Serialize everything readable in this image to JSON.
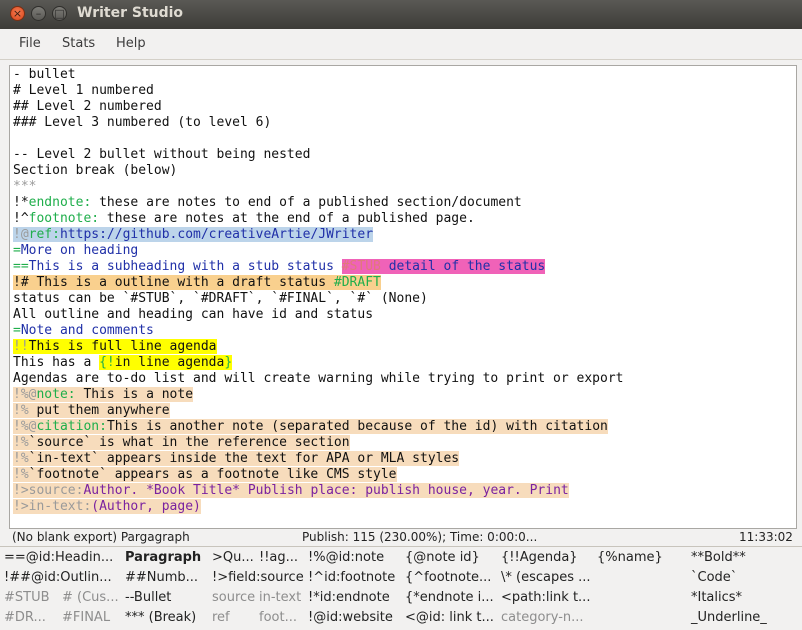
{
  "window": {
    "title": "Writer Studio"
  },
  "menu": [
    "File",
    "Stats",
    "Help"
  ],
  "editor_lines": [
    [
      {
        "t": "- bullet"
      }
    ],
    [
      {
        "t": "# Level 1 numbered"
      }
    ],
    [
      {
        "t": "## Level 2 numbered"
      }
    ],
    [
      {
        "t": "### Level 3 numbered (to level 6)"
      }
    ],
    [
      {
        "t": ""
      }
    ],
    [
      {
        "t": "-- Level 2 bullet without being nested"
      }
    ],
    [
      {
        "t": "Section break (below)"
      }
    ],
    [
      {
        "t": "***",
        "c": "gr"
      }
    ],
    [
      {
        "t": "!*",
        "c": ""
      },
      {
        "t": "endnote:",
        "c": "g"
      },
      {
        "t": " these are notes to end of a published section/document"
      }
    ],
    [
      {
        "t": "!^",
        "c": ""
      },
      {
        "t": "footnote:",
        "c": "g"
      },
      {
        "t": " these are notes at the end of a published page."
      }
    ],
    [
      {
        "t": "!@",
        "c": "hl-blue gr"
      },
      {
        "t": "ref:",
        "c": "hl-blue g"
      },
      {
        "t": "https://github.com/creativeArtie/JWriter",
        "c": "hl-blue bl"
      }
    ],
    [
      {
        "t": "=",
        "c": "g"
      },
      {
        "t": "More on heading",
        "c": "bl"
      }
    ],
    [
      {
        "t": "==",
        "c": "g"
      },
      {
        "t": "This is a subheading with a stub status ",
        "c": "bl"
      },
      {
        "t": "#STUB",
        "c": "hl-pink pi"
      },
      {
        "t": " detail of the status",
        "c": "hl-pink bl"
      }
    ],
    [
      {
        "t": "!# This is a outline with a draft status ",
        "c": "hl-orange"
      },
      {
        "t": "#DRAFT",
        "c": "hl-orange g"
      }
    ],
    [
      {
        "t": "status can be `#STUB`, `#DRAFT`, `#FINAL`, `#` (None)"
      }
    ],
    [
      {
        "t": "All outline and heading can have id and status"
      }
    ],
    [
      {
        "t": "=",
        "c": "g"
      },
      {
        "t": "Note and comments",
        "c": "bl"
      }
    ],
    [
      {
        "t": "!!",
        "c": "hl-yellow gr"
      },
      {
        "t": "This is full line agenda",
        "c": "hl-yellow"
      }
    ],
    [
      {
        "t": "This has a "
      },
      {
        "t": "{!",
        "c": "hl-yellow g"
      },
      {
        "t": "in line agenda",
        "c": "hl-yellow"
      },
      {
        "t": "}",
        "c": "hl-yellow g"
      }
    ],
    [
      {
        "t": "Agendas are to-do list and will create warning while trying to print or export"
      }
    ],
    [
      {
        "t": "!%@",
        "c": "hl-peach gr"
      },
      {
        "t": "note:",
        "c": "hl-peach g"
      },
      {
        "t": " This is a note",
        "c": "hl-peach"
      }
    ],
    [
      {
        "t": "!%",
        "c": "hl-peach gr"
      },
      {
        "t": " put them anywhere",
        "c": "hl-peach"
      }
    ],
    [
      {
        "t": "!%@",
        "c": "hl-peach gr"
      },
      {
        "t": "citation:",
        "c": "hl-peach g"
      },
      {
        "t": "This is another note (separated because of the id) with citation",
        "c": "hl-peach"
      }
    ],
    [
      {
        "t": "!%",
        "c": "hl-peach gr"
      },
      {
        "t": "`source` is what in the reference section",
        "c": "hl-peach"
      }
    ],
    [
      {
        "t": "!%",
        "c": "hl-peach gr"
      },
      {
        "t": "`in-text` appears inside the text for APA or MLA styles",
        "c": "hl-peach"
      }
    ],
    [
      {
        "t": "!%",
        "c": "hl-peach gr"
      },
      {
        "t": "`footnote` appears as a footnote like CMS style",
        "c": "hl-peach"
      }
    ],
    [
      {
        "t": "!>",
        "c": "hl-peach gr"
      },
      {
        "t": "source:",
        "c": "hl-peach gr"
      },
      {
        "t": "Author. ",
        "c": "hl-peach pu"
      },
      {
        "t": "*Book Title*",
        "c": "hl-peach pu"
      },
      {
        "t": " Publish place: publish house, year. Print",
        "c": "hl-peach pu"
      }
    ],
    [
      {
        "t": "!>",
        "c": "hl-peach gr"
      },
      {
        "t": "in-text:",
        "c": "hl-peach gr"
      },
      {
        "t": "(Author, page)",
        "c": "hl-peach pu"
      }
    ]
  ],
  "status": {
    "left": "(No blank export) Pargagraph",
    "middle": "Publish: 115 (230.00%); Time: 0:00:0...",
    "right": "11:33:02"
  },
  "legend": [
    [
      "==@id:Headin...",
      "Paragraph",
      ">Qu...",
      "!!ag...",
      "!%@id:note",
      "{@note id}",
      "{!!Agenda}",
      "{%name}",
      "**Bold**"
    ],
    [
      "!##@id:Outlin...",
      "##Numb...",
      "!>field:source",
      "!^id:footnote",
      "{^footnote...",
      "\\* (escapes ...",
      "`Code`"
    ],
    [
      "#STUB",
      "# (Cus...",
      "--Bullet",
      "source",
      "in-text",
      "!*id:endnote",
      "{*endnote i...",
      "<path:link t...",
      "*Italics*"
    ],
    [
      "#DR...",
      "#FINAL",
      "*** (Break)",
      "ref",
      "foot...",
      "!@id:website",
      "<@id: link t...",
      "category-n...",
      "_Underline_"
    ]
  ]
}
